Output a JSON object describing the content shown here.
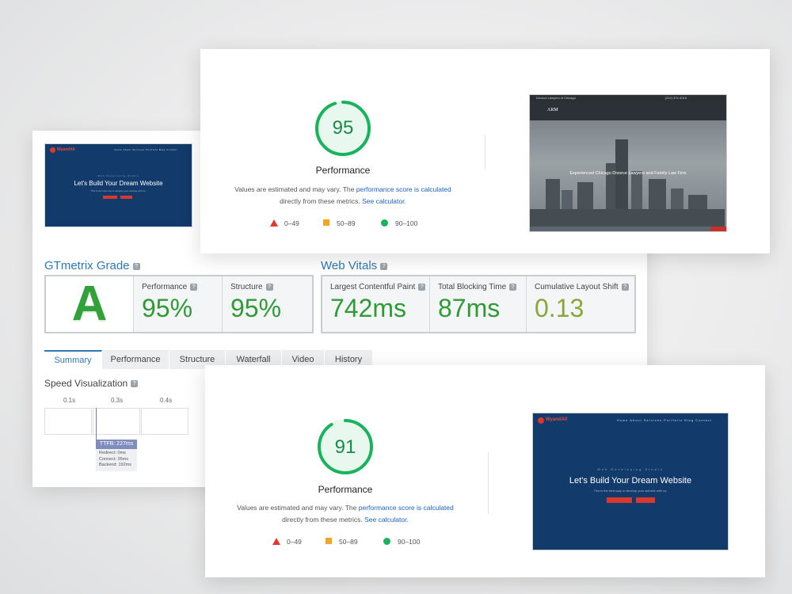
{
  "gtmetrix": {
    "thumbnail": {
      "logo": "WyandAll",
      "nav": "Home  About  Services  Portfolio  Blog  Contact",
      "tagline": "Web Developing Studio",
      "headline": "Let's Build Your Dream Website",
      "subline": "This is the best way to develop your website with us."
    },
    "grade_title": "GTmetrix Grade",
    "grade": "A",
    "performance_label": "Performance",
    "performance_value": "95%",
    "structure_label": "Structure",
    "structure_value": "95%",
    "vitals_title": "Web Vitals",
    "lcp_label": "Largest Contentful Paint",
    "lcp_value": "742ms",
    "tbt_label": "Total Blocking Time",
    "tbt_value": "87ms",
    "cls_label": "Cumulative Layout Shift",
    "cls_value": "0.13",
    "tabs": [
      "Summary",
      "Performance",
      "Structure",
      "Waterfall",
      "Video",
      "History"
    ],
    "speed_title": "Speed Visualization",
    "ticks": [
      "0.1s",
      "0.3s",
      "0.4s"
    ],
    "ttfb": "TTFB: 227ms",
    "ttfb_redirect": "Redirect: 0ms",
    "ttfb_connect": "Connect: 35ms",
    "ttfb_backend": "Backend: 192ms"
  },
  "lighthouse_top": {
    "score": "95",
    "score_fraction": 0.95,
    "title": "Performance",
    "note_1": "Values are estimated and may vary. The ",
    "note_link_1": "performance score is calculated",
    "note_2": "directly from these metrics. ",
    "note_link_2": "See calculator.",
    "legend_red": "0–49",
    "legend_orange": "50–89",
    "legend_green": "90–100",
    "screenshot": {
      "topbar": "Divorce Lawyers of Chicago",
      "phone": "(312) 372-4015",
      "brand": "ARM",
      "headline": "Experienced Chicago Divorce Lawyers and Family Law Firm"
    }
  },
  "lighthouse_bottom": {
    "score": "91",
    "score_fraction": 0.91,
    "title": "Performance",
    "note_1": "Values are estimated and may vary. The ",
    "note_link_1": "performance score is calculated",
    "note_2": "directly from these metrics. ",
    "note_link_2": "See calculator.",
    "legend_red": "0–49",
    "legend_orange": "50–89",
    "legend_green": "90–100",
    "screenshot": {
      "logo": "WyandAll",
      "nav": "Home  About  Services  Portfolio  Blog  Contact",
      "tagline": "Web Developing Studio",
      "headline": "Let's Build Your Dream Website",
      "subline": "This is the best way to develop your website with us."
    }
  },
  "colors": {
    "gauge_green": "#18b45c",
    "grade_green": "#33a13a",
    "link_blue": "#1a62c8",
    "gtm_blue": "#2c79b9"
  }
}
